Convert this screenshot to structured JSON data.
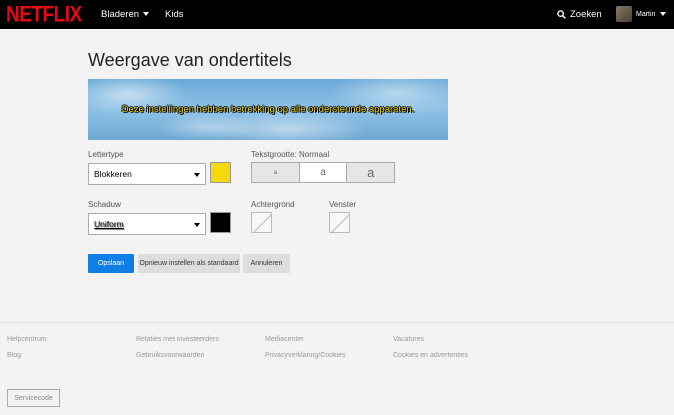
{
  "header": {
    "logo": "NETFLIX",
    "nav_browse": "Bladeren",
    "nav_kids": "Kids",
    "search_label": "Zoeken",
    "profile_name": "Martin"
  },
  "page": {
    "title": "Weergave van ondertitels",
    "preview_text": "Deze instellingen hebben betrekking op alle ondersteunde apparaten."
  },
  "settings": {
    "font_label": "Lettertype",
    "font_value": "Blokkeren",
    "font_color": "#f5d90a",
    "size_label": "Tekstgrootte: Normaal",
    "size_options": [
      "a",
      "a",
      "a"
    ],
    "size_selected_index": 1,
    "shadow_label": "Schaduw",
    "shadow_value": "Uniform",
    "shadow_color": "#000000",
    "background_label": "Achtergrond",
    "window_label": "Venster"
  },
  "actions": {
    "save": "Opslaan",
    "reset": "Opnieuw instellen als standaard",
    "cancel": "Annuleren"
  },
  "footer": {
    "links": [
      [
        "Helpcentrum",
        "Relaties met investeerders",
        "Mediacenter",
        "Vacatures"
      ],
      [
        "Blog",
        "Gebruiksvoorwaarden",
        "Privacyverklaring/Cookies",
        "Cookies en advertenties"
      ]
    ],
    "service_code": "Servicecode"
  }
}
